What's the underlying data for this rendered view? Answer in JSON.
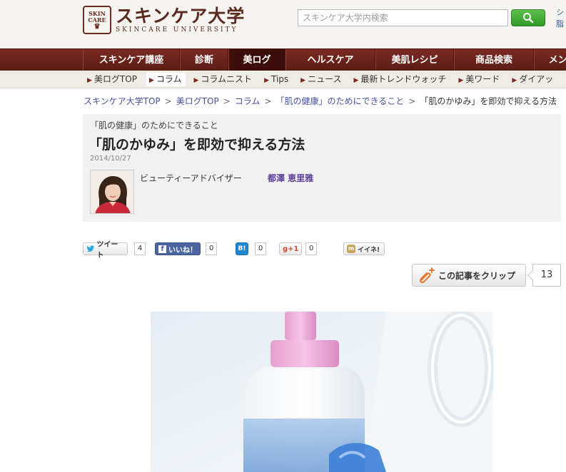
{
  "header": {
    "logo_badge_top": "SKIN",
    "logo_badge_mid": "CARE",
    "logo_main": "スキンケア大学",
    "logo_sub": "SKINCARE UNIVERSITY",
    "search_placeholder": "スキンケア大学内検索",
    "right_line1": "シ",
    "right_line2": "脂"
  },
  "main_nav": [
    {
      "label": "スキンケア講座",
      "width": 136
    },
    {
      "label": "診断",
      "width": 68
    },
    {
      "label": "美ログ",
      "width": 80,
      "active": true
    },
    {
      "label": "ヘルスケア",
      "width": 126
    },
    {
      "label": "美肌レシピ",
      "width": 110
    },
    {
      "label": "商品検索",
      "width": 112
    },
    {
      "label": "メンズ",
      "width": 80
    }
  ],
  "sub_nav": [
    {
      "label": "美ログTOP"
    },
    {
      "label": "コラム",
      "active": true
    },
    {
      "label": "コラムニスト"
    },
    {
      "label": "Tips"
    },
    {
      "label": "ニュース"
    },
    {
      "label": "最新トレンドウォッチ"
    },
    {
      "label": "美ワード"
    },
    {
      "label": "ダイアッ"
    }
  ],
  "breadcrumb": {
    "items": [
      "スキンケア大学TOP",
      "美ログTOP",
      "コラム",
      "「肌の健康」のためにできること"
    ],
    "current": "「肌のかゆみ」を即効で抑える方法",
    "separator": ">"
  },
  "article": {
    "series": "「肌の健康」のためにできること",
    "title": "「肌のかゆみ」を即効で抑える方法",
    "date": "2014/10/27",
    "author_role": "ビューティーアドバイザー",
    "author_name": "都澤 恵里雅"
  },
  "social": {
    "tweet_label": "ツイート",
    "tweet_count": "4",
    "like_label": "いいね！",
    "like_count": "0",
    "hatena_label": "B!",
    "hatena_count": "0",
    "gplus_label": "+1",
    "gplus_count": "0",
    "iine_label": "イイネ!"
  },
  "clip": {
    "label": "この記事をクリップ",
    "count": "13"
  },
  "colors": {
    "nav_bg": "#5c1d17",
    "nav_active": "#3c0d09",
    "link": "#47509a",
    "author": "#5c3d99",
    "search_btn": "#3aa82c"
  }
}
